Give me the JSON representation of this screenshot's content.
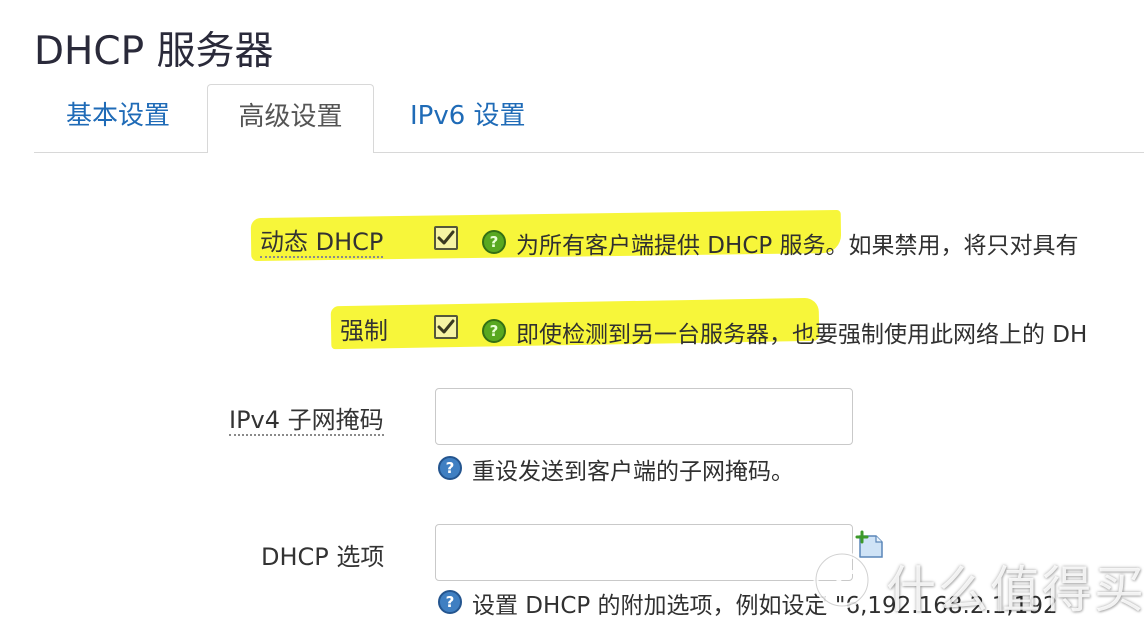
{
  "page": {
    "title": "DHCP 服务器"
  },
  "tabs": [
    {
      "label": "基本设置",
      "active": false
    },
    {
      "label": "高级设置",
      "active": true
    },
    {
      "label": "IPv6 设置",
      "active": false
    }
  ],
  "fields": {
    "dynamic_dhcp": {
      "label": "动态 DHCP",
      "checked": true,
      "description": "为所有客户端提供 DHCP 服务。如果禁用，将只对具有"
    },
    "force": {
      "label": "强制",
      "checked": true,
      "description": "即使检测到另一台服务器，也要强制使用此网络上的 DH"
    },
    "ipv4_netmask": {
      "label": "IPv4 子网掩码",
      "value": "",
      "description": "重设发送到客户端的子网掩码。"
    },
    "dhcp_options": {
      "label": "DHCP 选项",
      "value": "",
      "description": "设置 DHCP 的附加选项，例如设定 \"6,192.168.2.1,192"
    }
  },
  "watermark": {
    "text": "什么值得买"
  },
  "colors": {
    "tab_link": "#1f6bb7",
    "highlight": "#f7f52f",
    "help_green": "#58a820",
    "help_blue": "#3f7fc2"
  }
}
